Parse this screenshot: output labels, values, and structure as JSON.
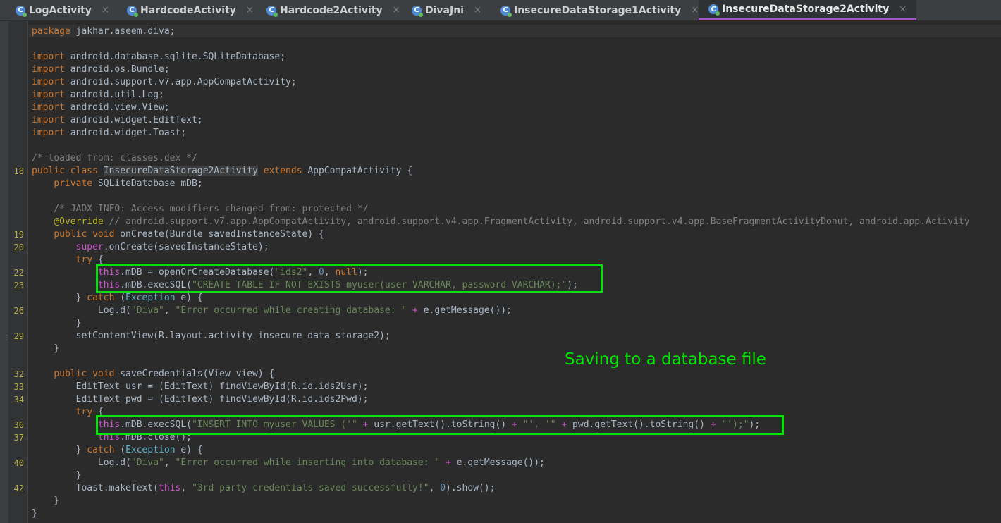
{
  "tabs": [
    {
      "label": "LogActivity",
      "icon": "java-class-icon",
      "active": false
    },
    {
      "label": "HardcodeActivity",
      "icon": "java-class-icon",
      "active": false
    },
    {
      "label": "Hardcode2Activity",
      "icon": "java-class-icon",
      "active": false
    },
    {
      "label": "DivaJni",
      "icon": "java-class-icon",
      "active": false
    },
    {
      "label": "InsecureDataStorage1Activity",
      "icon": "java-class-icon",
      "active": false
    },
    {
      "label": "InsecureDataStorage2Activity",
      "icon": "java-class-icon",
      "active": true
    }
  ],
  "tab_close_glyph": "×",
  "tab_icon_glyph": "C",
  "line_numbers": [
    "18",
    "19",
    "20",
    "22",
    "23",
    "26",
    "29",
    "32",
    "33",
    "34",
    "36",
    "37",
    "40",
    "42"
  ],
  "code": {
    "l1": [
      "package",
      " jakhar.aseem.diva;"
    ],
    "imports": [
      "import",
      " android.database.sqlite.SQLiteDatabase;",
      "import",
      " android.os.Bundle;",
      "import",
      " android.support.v7.app.AppCompatActivity;",
      "import",
      " android.util.Log;",
      "import",
      " android.view.View;",
      "import",
      " android.widget.EditText;",
      "import",
      " android.widget.Toast;"
    ],
    "loaded_comment": "/* loaded from: classes.dex */",
    "class_decl": [
      "public class",
      " ",
      "InsecureDataStorage2Activity",
      " ",
      "extends",
      " AppCompatActivity {"
    ],
    "field": [
      "    ",
      "private",
      " SQLiteDatabase mDB;"
    ],
    "jadx_comment": "    /* JADX INFO: Access modifiers changed from: protected */",
    "override": [
      "    ",
      "@Override",
      " // android.support.v7.app.AppCompatActivity, android.support.v4.app.FragmentActivity, android.support.v4.app.BaseFragmentActivityDonut, android.app.Activity"
    ],
    "oncreate": [
      "    ",
      "public void",
      " onCreate(Bundle savedInstanceState) {"
    ],
    "super_call": [
      "        ",
      "super",
      ".onCreate(savedInstanceState);"
    ],
    "try1": [
      "        ",
      "try",
      " {"
    ],
    "open_db": [
      "            ",
      "this",
      ".mDB = openOrCreateDatabase(",
      "\"ids2\"",
      ", ",
      "0",
      ", ",
      "null",
      ");"
    ],
    "create_table": [
      "            ",
      "this",
      ".mDB.execSQL(",
      "\"CREATE TABLE IF NOT EXISTS myuser(user VARCHAR, password VARCHAR);\"",
      ");"
    ],
    "catch1": [
      "        } ",
      "catch",
      " (",
      "Exception",
      " e) {"
    ],
    "log1": [
      "            Log.d(",
      "\"Diva\"",
      ", ",
      "\"Error occurred while creating database: \"",
      " ",
      "+",
      " e.getMessage());"
    ],
    "close_brace_8": "        }",
    "set_content": "        setContentView(R.layout.activity_insecure_data_storage2);",
    "close_brace_4": "    }",
    "save_creds": [
      "    ",
      "public void",
      " saveCredentials(View view) {"
    ],
    "usr": "        EditText usr = (EditText) findViewById(R.id.ids2Usr);",
    "pwd": "        EditText pwd = (EditText) findViewById(R.id.ids2Pwd);",
    "try2": [
      "        ",
      "try",
      " {"
    ],
    "insert": [
      "            ",
      "this",
      ".mDB.execSQL(",
      "\"INSERT INTO myuser VALUES ('\"",
      " ",
      "+",
      " usr.getText().toString() ",
      "+",
      " ",
      "\"', '\"",
      " ",
      "+",
      " pwd.getText().toString() ",
      "+",
      " ",
      "\"');\"",
      ");"
    ],
    "close_db": [
      "            ",
      "this",
      ".mDB.close();"
    ],
    "catch2": [
      "        } ",
      "catch",
      " (",
      "Exception",
      " e) {"
    ],
    "log2": [
      "            Log.d(",
      "\"Diva\"",
      ", ",
      "\"Error occurred while inserting into database: \"",
      " ",
      "+",
      " e.getMessage());"
    ],
    "toast": [
      "        Toast.makeText(",
      "this",
      ", ",
      "\"3rd party credentials saved successfully!\"",
      ", ",
      "0",
      ").show();"
    ],
    "close_brace_4b": "    }",
    "close_brace_0": "}"
  },
  "annotation": "Saving to a database file",
  "colors": {
    "highlight_box": "#00e600",
    "active_tab_underline": "#a557c9",
    "keyword": "#cc7832",
    "string": "#6a8759",
    "line_number": "#b8b24a"
  }
}
